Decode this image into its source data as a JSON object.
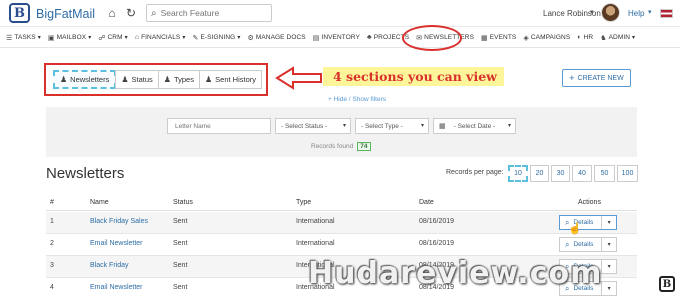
{
  "app": {
    "brand": "BigFatMail",
    "logo_letter": "B"
  },
  "topbar": {
    "search_placeholder": "Search Feature",
    "user_name": "Lance Robinson",
    "help_label": "Help"
  },
  "nav": [
    {
      "icon": "list-icon",
      "glyph": "☰",
      "label": "TASKS",
      "caret": true
    },
    {
      "icon": "mailbox-icon",
      "glyph": "▣",
      "label": "MAILBOX",
      "caret": true
    },
    {
      "icon": "crm-icon",
      "glyph": "☍",
      "label": "CRM",
      "caret": true
    },
    {
      "icon": "bank-icon",
      "glyph": "⌂",
      "label": "FINANCIALS",
      "caret": true
    },
    {
      "icon": "pen-icon",
      "glyph": "✎",
      "label": "E-SIGNING",
      "caret": true
    },
    {
      "icon": "docs-icon",
      "glyph": "⚙",
      "label": "MANAGE DOCS",
      "caret": false
    },
    {
      "icon": "inventory-icon",
      "glyph": "▤",
      "label": "INVENTORY",
      "caret": false
    },
    {
      "icon": "projects-icon",
      "glyph": "♣",
      "label": "PROJECTS",
      "caret": false
    },
    {
      "icon": "envelope-icon",
      "glyph": "✉",
      "label": "NEWSLETTERS",
      "caret": false
    },
    {
      "icon": "events-icon",
      "glyph": "▦",
      "label": "EVENTS",
      "caret": false
    },
    {
      "icon": "campaigns-icon",
      "glyph": "◈",
      "label": "CAMPAIGNS",
      "caret": false
    },
    {
      "icon": "hr-icon",
      "glyph": "◐",
      "label": "HR",
      "caret": false
    },
    {
      "icon": "admin-icon",
      "glyph": "♞",
      "label": "ADMIN",
      "caret": true
    }
  ],
  "sections": {
    "tabs": [
      "Newsletters",
      "Status",
      "Types",
      "Sent History"
    ],
    "callout": "4 sections you can view",
    "create_label": "CREATE NEW",
    "filters_link": "+ Hide / Show filters"
  },
  "filters": {
    "name_placeholder": "Letter Name",
    "status": "- Select Status -",
    "type": "- Select Type -",
    "date": "- Select Date -",
    "records_label": "Records found",
    "records_count": "74"
  },
  "table": {
    "title": "Newsletters",
    "rpp_label": "Records per page:",
    "rpp_options": [
      "10",
      "20",
      "30",
      "40",
      "50",
      "100"
    ],
    "rpp_selected": "10",
    "headers": [
      "#",
      "Name",
      "Status",
      "Type",
      "Date",
      "Actions"
    ],
    "details_label": "Details",
    "rows": [
      {
        "num": "1",
        "name": "Black Friday Sales",
        "status": "Sent",
        "type": "International",
        "date": "08/16/2019"
      },
      {
        "num": "2",
        "name": "Email Newsletter",
        "status": "Sent",
        "type": "International",
        "date": "08/16/2019"
      },
      {
        "num": "3",
        "name": "Black Friday",
        "status": "Sent",
        "type": "International",
        "date": "08/14/2019"
      },
      {
        "num": "4",
        "name": "Email Newsletter",
        "status": "Sent",
        "type": "International",
        "date": "08/14/2019"
      }
    ]
  },
  "watermark": "Hudareview.com"
}
